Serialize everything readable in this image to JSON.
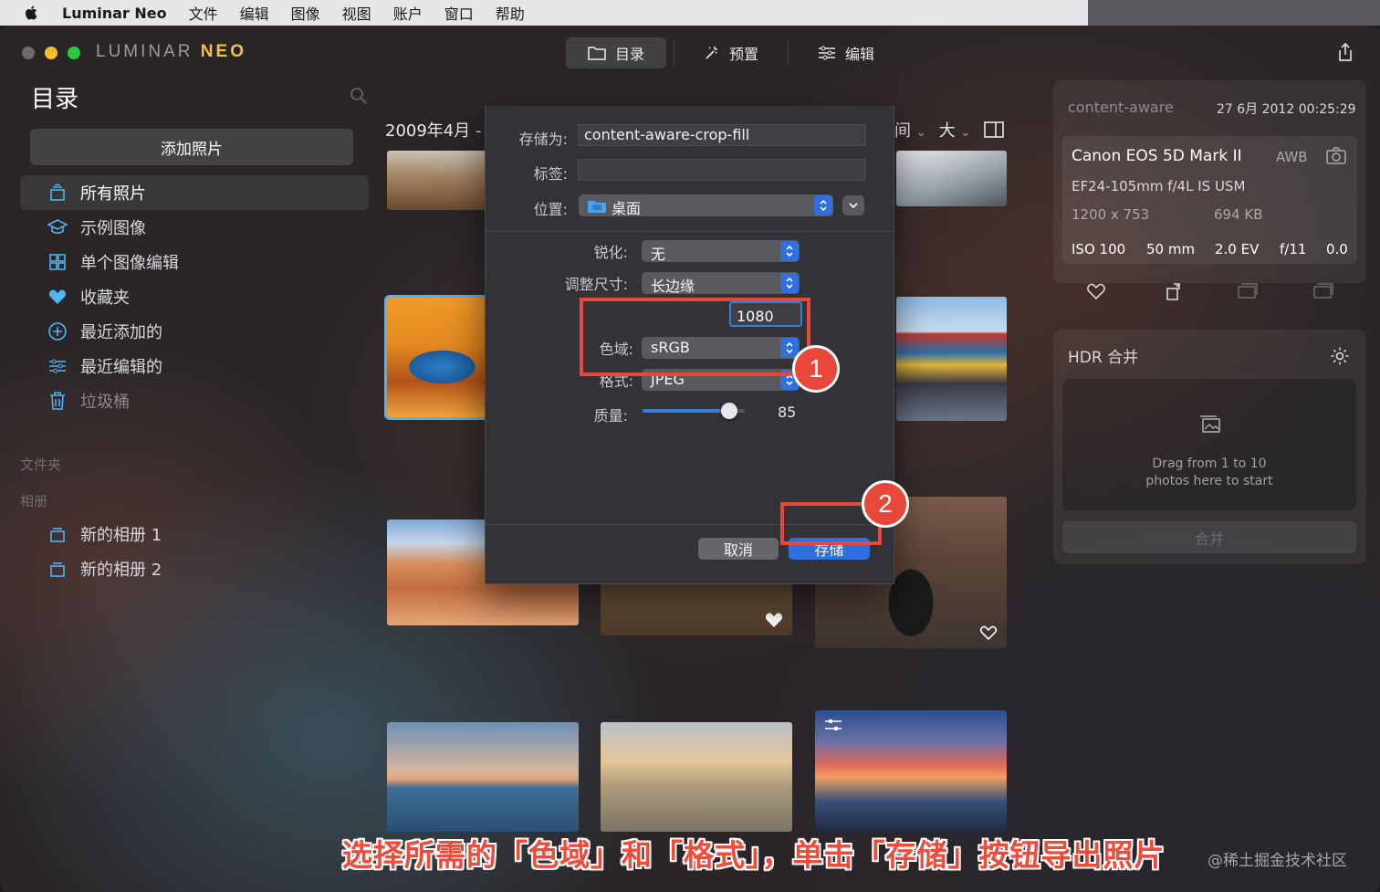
{
  "menubar": {
    "app_name": "Luminar Neo",
    "items": [
      "文件",
      "编辑",
      "图像",
      "视图",
      "账户",
      "窗口",
      "帮助"
    ]
  },
  "window": {
    "logo_a": "LUMINAR",
    "logo_b": "NEO",
    "tabs": [
      {
        "label": "目录",
        "icon": "folder-icon",
        "active": true
      },
      {
        "label": "预置",
        "icon": "magic-wand-icon",
        "active": false
      },
      {
        "label": "编辑",
        "icon": "sliders-icon",
        "active": false
      }
    ]
  },
  "sidebar": {
    "title": "目录",
    "add_photos": "添加照片",
    "items": [
      {
        "label": "所有照片",
        "icon": "stack-icon"
      },
      {
        "label": "示例图像",
        "icon": "graduation-cap-icon"
      },
      {
        "label": "单个图像编辑",
        "icon": "grid-icon"
      },
      {
        "label": "收藏夹",
        "icon": "heart-icon"
      },
      {
        "label": "最近添加的",
        "icon": "plus-circle-icon"
      },
      {
        "label": "最近编辑的",
        "icon": "sliders-icon"
      },
      {
        "label": "垃圾桶",
        "icon": "trash-icon"
      }
    ],
    "folders_label": "文件夹",
    "albums_label": "相册",
    "albums": [
      {
        "label": "新的相册 1"
      },
      {
        "label": "新的相册 2"
      }
    ]
  },
  "gallery": {
    "date_header": "2009年4月 -",
    "sort_label": "间",
    "size_label": "大"
  },
  "save_dialog": {
    "save_as_label": "存储为:",
    "save_as_value": "content-aware-crop-fill",
    "tags_label": "标签:",
    "tags_value": "",
    "location_label": "位置:",
    "location_value": "桌面",
    "sharpen_label": "锐化:",
    "sharpen_value": "无",
    "resize_label": "调整尺寸:",
    "resize_value": "长边缘",
    "size_value": "1080",
    "colorspace_label": "色域:",
    "colorspace_value": "sRGB",
    "format_label": "格式:",
    "format_value": "JPEG",
    "quality_label": "质量:",
    "quality_value": "85",
    "quality_fraction": 0.85,
    "cancel": "取消",
    "save": "存储"
  },
  "annotations": {
    "badge1": "1",
    "badge2": "2",
    "caption": "选择所需的「色域」和「格式」，单击「存储」按钮导出照片",
    "watermark": "@稀土掘金技术社区",
    "accent": "#e8473a"
  },
  "info_panel": {
    "filename": "content-aware",
    "datetime": "27 6月 2012 00:25:29",
    "camera": "Canon EOS 5D Mark II",
    "wb": "AWB",
    "lens": "EF24-105mm f/4L IS USM",
    "dimensions": "1200 x 753",
    "filesize": "694 KB",
    "iso": "ISO 100",
    "focal": "50 mm",
    "ev": "2.0 EV",
    "aperture": "f/11",
    "exposure": "0.0"
  },
  "hdr_panel": {
    "title": "HDR 合并",
    "drop_line1": "Drag from 1 to 10",
    "drop_line2": "photos here to start",
    "merge": "合并"
  }
}
